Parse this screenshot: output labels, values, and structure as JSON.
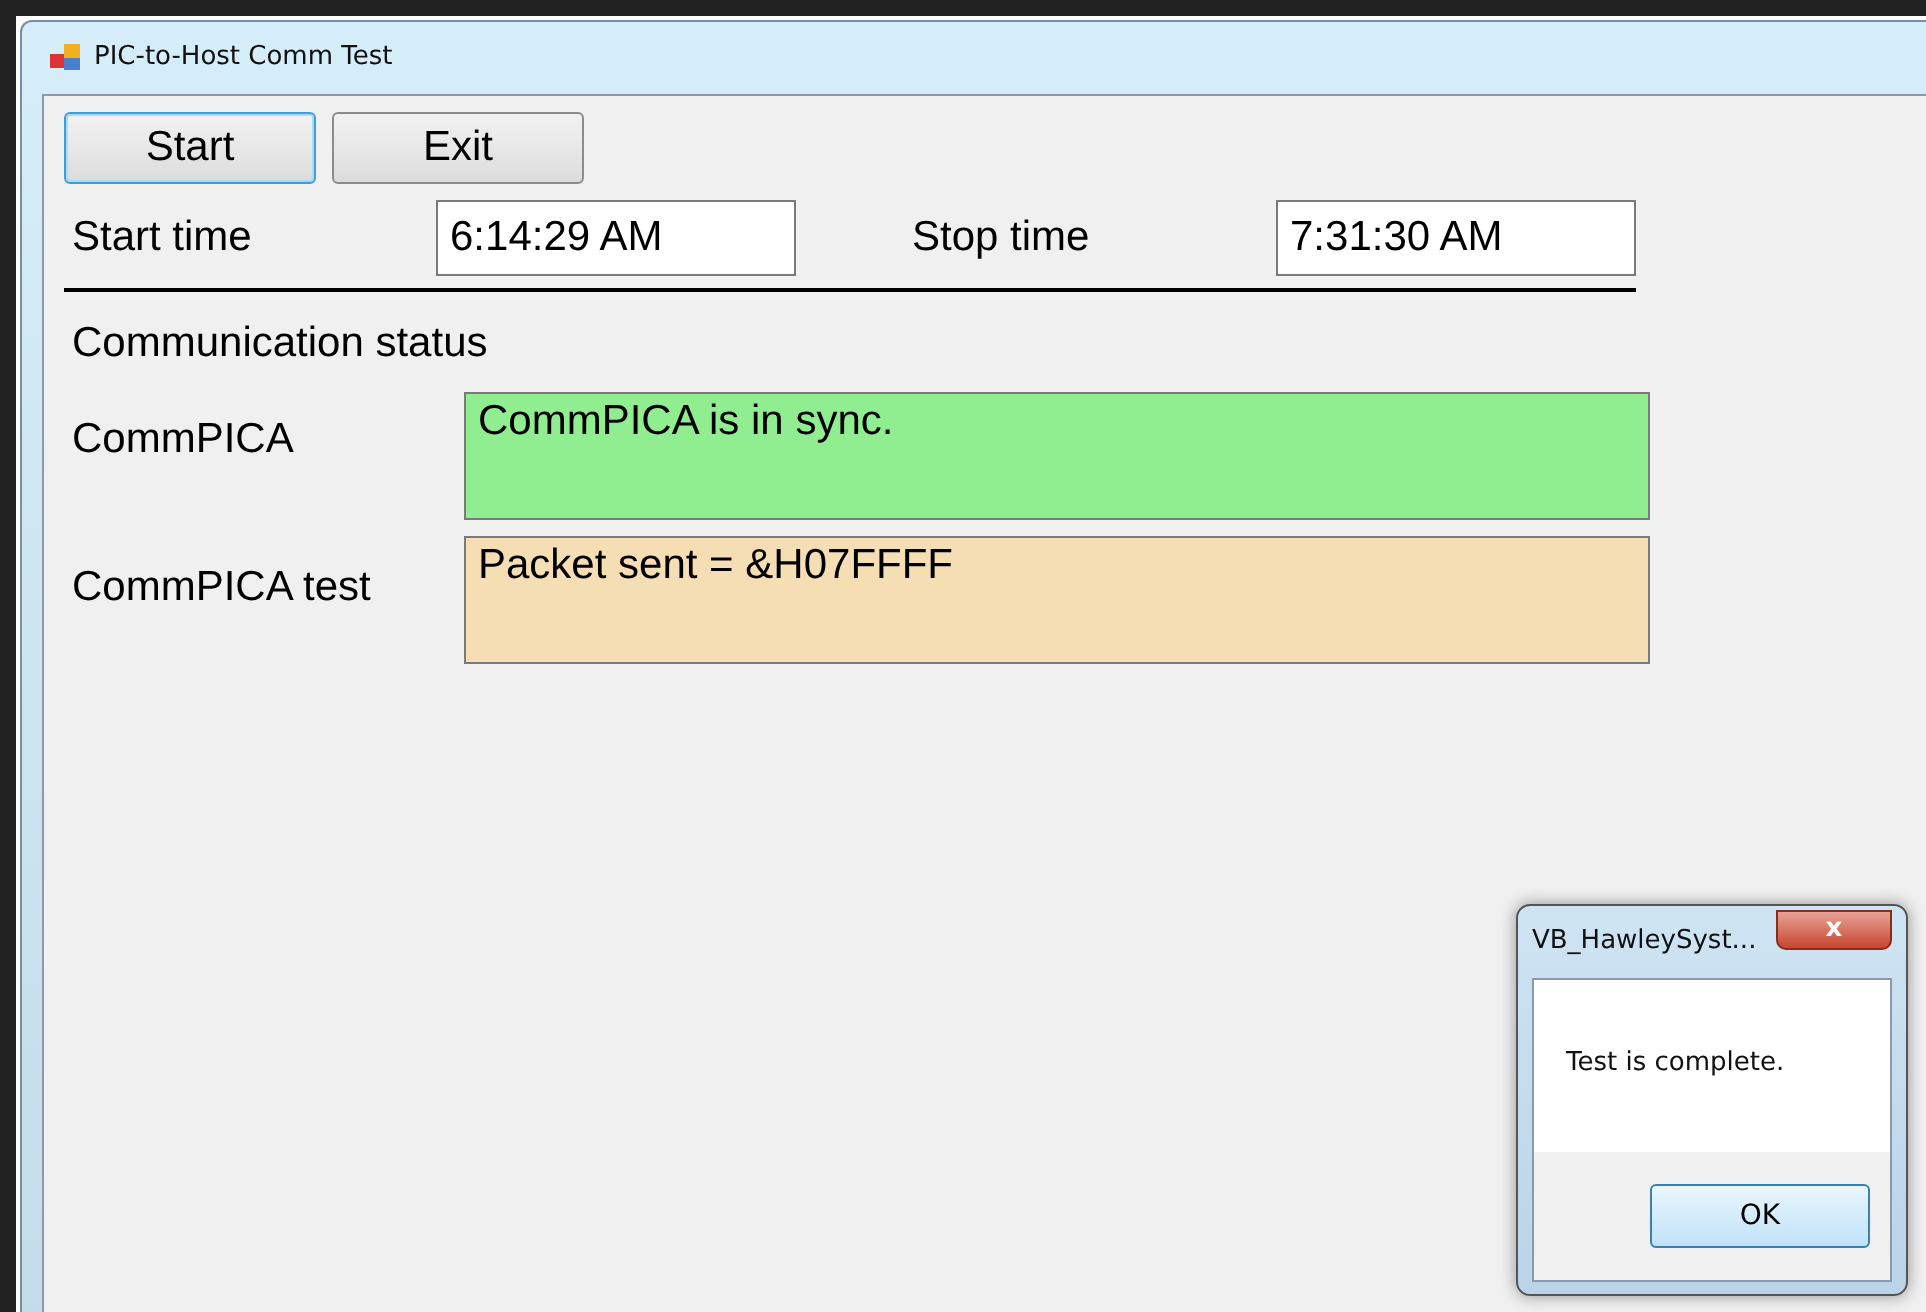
{
  "window": {
    "title": "PIC-to-Host Comm Test"
  },
  "buttons": [
    {
      "label": "Start",
      "focused": true
    },
    {
      "label": "Exit",
      "focused": false
    }
  ],
  "times": [
    {
      "label": "Start time",
      "value": "6:14:29 AM"
    },
    {
      "label": "Stop time",
      "value": "7:31:30 AM"
    }
  ],
  "status_heading": "Communication status",
  "status": [
    {
      "label": "CommPICA",
      "text": "CommPICA is in sync.",
      "color": "#90ee90"
    },
    {
      "label": "CommPICA test",
      "text": "Packet sent = &H07FFFF",
      "color": "#f5deb3"
    }
  ],
  "message_box": {
    "title": "VB_HawleySyst...",
    "close": "x",
    "message": "Test is complete.",
    "button": {
      "label": "OK",
      "focused": true
    }
  }
}
